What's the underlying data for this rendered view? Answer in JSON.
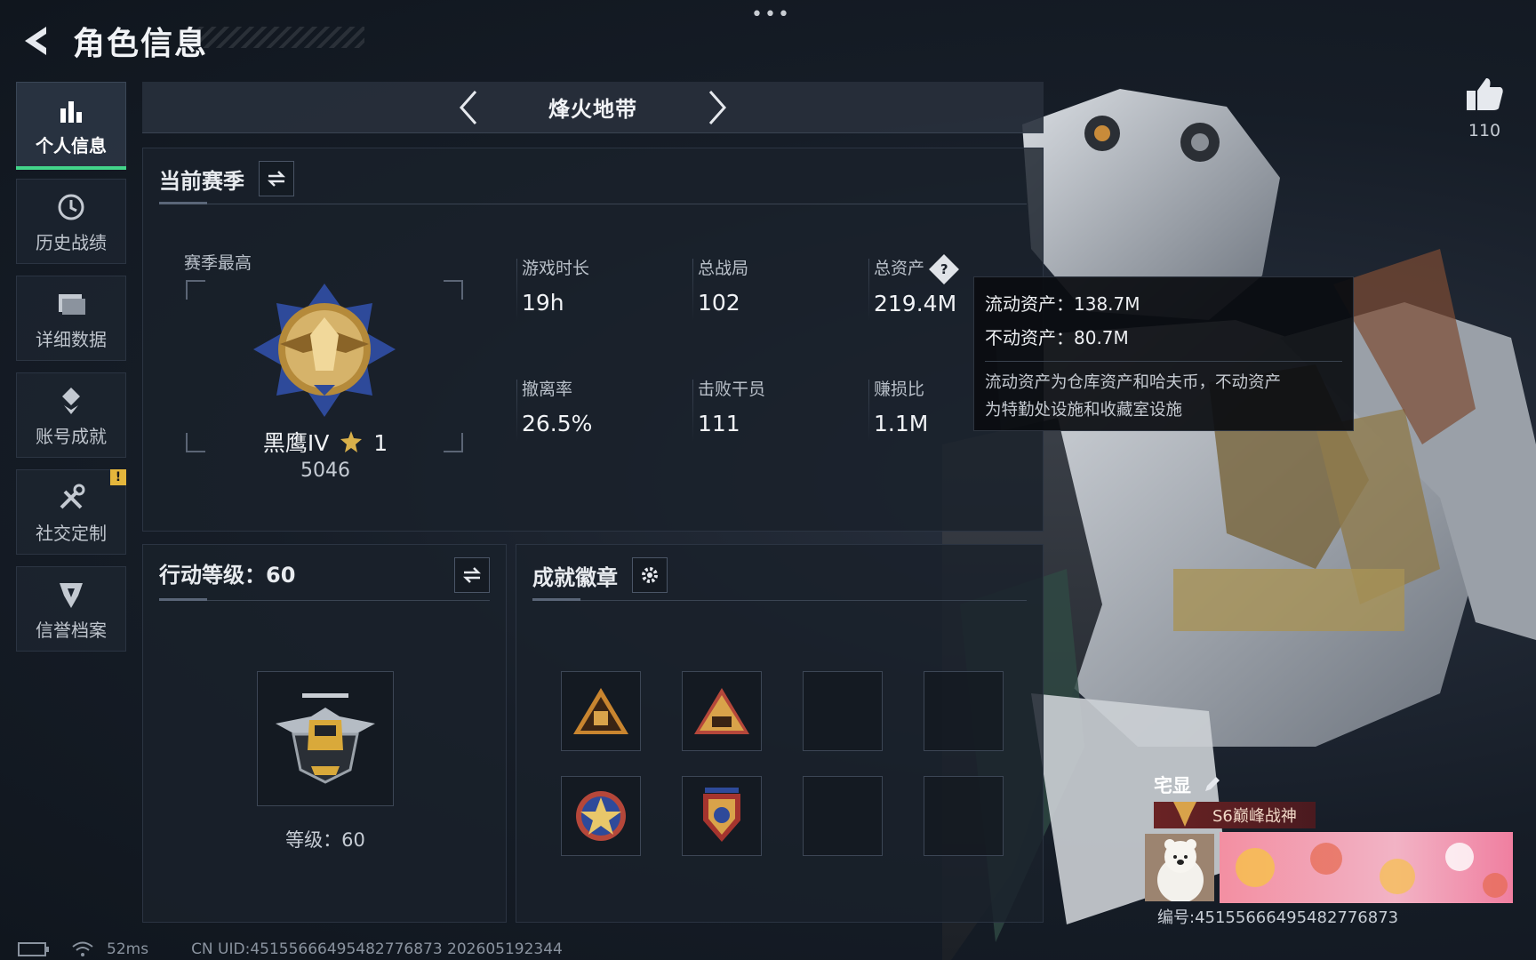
{
  "header": {
    "title": "角色信息"
  },
  "sidebar": {
    "items": [
      {
        "label": "个人信息",
        "icon": "bar-chart-icon",
        "active": true
      },
      {
        "label": "历史战绩",
        "icon": "history-icon"
      },
      {
        "label": "详细数据",
        "icon": "folder-icon"
      },
      {
        "label": "账号成就",
        "icon": "achievement-icon"
      },
      {
        "label": "社交定制",
        "icon": "tools-icon",
        "badge": "!"
      },
      {
        "label": "信誉档案",
        "icon": "shield-icon"
      }
    ]
  },
  "mode": {
    "name": "烽火地带"
  },
  "season": {
    "title": "当前赛季",
    "best_label": "赛季最高",
    "rank_name": "黑鹰IV",
    "rank_stars": "1",
    "rank_score": "5046",
    "stats": [
      {
        "label": "游戏时长",
        "value": "19h"
      },
      {
        "label": "总战局",
        "value": "102"
      },
      {
        "label": "总资产",
        "value": "219.4M"
      },
      {
        "label": "撤离率",
        "value": "26.5%"
      },
      {
        "label": "击败干员",
        "value": "111"
      },
      {
        "label": "赚损比",
        "value": "1.1M"
      }
    ]
  },
  "tooltip": {
    "liquid": "流动资产：138.7M",
    "fixed": "不动资产：80.7M",
    "desc_line1": "流动资产为仓库资产和哈夫币，不动资产",
    "desc_line2": "为特勤处设施和收藏室设施"
  },
  "level": {
    "title": "行动等级：60",
    "level_text": "等级：60"
  },
  "achievements": {
    "title": "成就徽章"
  },
  "like": {
    "count": "110"
  },
  "player": {
    "name": "宅显",
    "title_badge": "S6巅峰战神",
    "id_text": "编号:451556664954827768​73"
  },
  "status": {
    "ping": "52ms",
    "uid": "CN UID:451556664954827768​73 202605192344"
  },
  "colors": {
    "accent_green": "#43d58a",
    "warning_yellow": "#e4b63c"
  }
}
